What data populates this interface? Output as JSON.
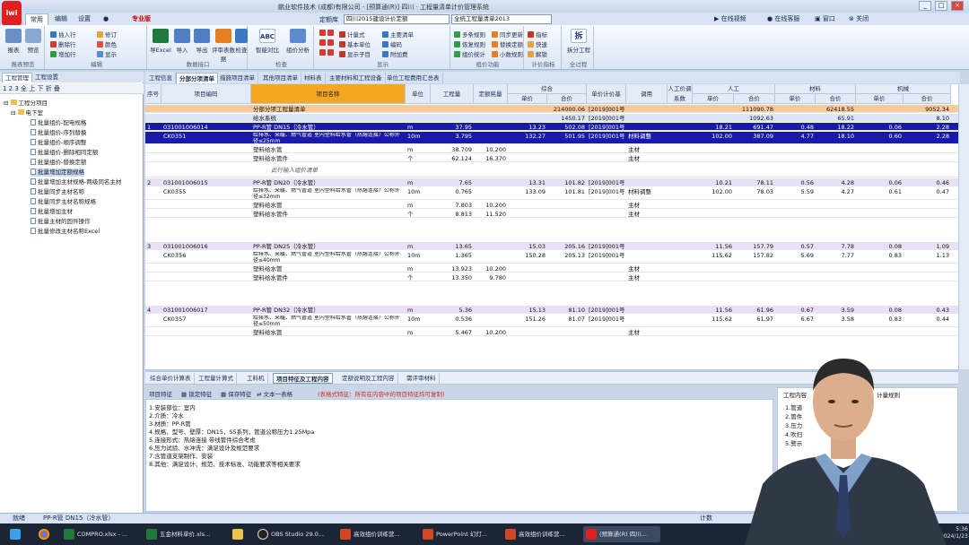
{
  "app": {
    "logo": "iwi",
    "title": "鹏业软件技术 (成都)有限公司 · [预算通(R)] 四川 · 工程量清单计价管理系统"
  },
  "ribbon_tabs": [
    "常用",
    "编辑",
    "设置",
    "",
    "专业版"
  ],
  "combo": {
    "quota_label": "定额库",
    "quota_value": "四川2015建设计价定额",
    "bill_value": "全统工程量清单2013"
  },
  "top_links": [
    "在线视频",
    "在线客服",
    "窗口",
    "关闭"
  ],
  "ribbon_groups": [
    {
      "label": "报表预览",
      "big": [
        "报表",
        "预览"
      ]
    },
    {
      "label": "编辑",
      "small": [
        "插入行",
        "删除行",
        "增加行",
        "修订",
        "颜色",
        "显示"
      ]
    },
    {
      "label": "数据接口",
      "big": [
        "导Excel",
        "导入",
        "导出",
        "评审表数据",
        "检查"
      ]
    },
    {
      "label": "检查",
      "big": [
        "智能对比",
        "组价分析"
      ]
    },
    {
      "label": "显示",
      "small": [
        "计量式",
        "主要清单",
        "多条规则",
        "基本单位",
        "编码",
        "恢复规则",
        "显示子目",
        "附加费",
        "组价统计"
      ]
    },
    {
      "label": "组价功能",
      "small": [
        "同步更新",
        "替换定额",
        "小数规则"
      ]
    },
    {
      "label": "计价指标",
      "small": [
        "指标",
        "快速",
        "解锁"
      ]
    },
    {
      "label": "全过程",
      "big": [
        "拆分工程"
      ]
    }
  ],
  "sidebar": {
    "tabs": [
      "工程管理",
      "工程设置"
    ],
    "tools": "1 2 3  全  上  下  折  叠",
    "root": "工程分项目",
    "folder": "电下室",
    "items": [
      "批量组价-配电规格",
      "批量组价-序列替换",
      "批量组价-顺序调整",
      "批量组价-删除相同定额",
      "批量组价-替换定额",
      "批量增加定额规格",
      "批量增加主材规格-两级同名主材",
      "批量同步主材名称",
      "批量同步主材名称规格",
      "批量增加主材",
      "批量主材的固件操作",
      "批量修改主材名称Excel"
    ]
  },
  "main_tabs": [
    "工程信息",
    "分部分项清单",
    "措施项目清单",
    "其他项目清单",
    "材料表",
    "主要材料和工程设备",
    "单位工程费用汇总表"
  ],
  "grid_headers": {
    "seq": "序号",
    "code": "项目编码",
    "name": "项目名称",
    "unit": "单位",
    "qty": "工程量",
    "quota_qty": "定额耗量",
    "composite": "综合",
    "unit_price": "单价",
    "total": "合价",
    "basis": "单价计价基",
    "adjust": "调用",
    "labor_coef": "人工价调系数",
    "labor": "人工",
    "material": "材料",
    "machine": "机械"
  },
  "rows": [
    {
      "seq": "",
      "code": "",
      "name": "分部分项工程量清单",
      "unit": "",
      "qty": "",
      "qq": "",
      "price": "",
      "total": "214000.06",
      "basis": "[2019]001号",
      "adj": "",
      "lp": "",
      "lt": "111090.78",
      "mp": "",
      "mt": "62418.55",
      "kp": "",
      "kt": "9052.34",
      "kind": "sum"
    },
    {
      "seq": "",
      "code": "",
      "name": "给水系统",
      "unit": "",
      "qty": "",
      "qq": "",
      "price": "",
      "total": "1450.17",
      "basis": "[2019]001号",
      "adj": "",
      "lp": "",
      "lt": "1092.63",
      "mp": "",
      "mt": "65.91",
      "kp": "",
      "kt": "8.10",
      "kind": "sub"
    },
    {
      "seq": "1",
      "code": "031001006014",
      "name": "PP-R管 DN15（冷水管）",
      "unit": "m",
      "qty": "37.95",
      "qq": "",
      "price": "13.23",
      "total": "502.08",
      "basis": "[2019]001号",
      "adj": "",
      "lp": "18.21",
      "lt": "691.47",
      "mp": "0.48",
      "mt": "18.22",
      "kp": "0.06",
      "kt": "2.28",
      "kind": "sel"
    },
    {
      "seq": "",
      "code": "CK0351",
      "name": "给排水、采暖、燃气管道 室内塑料给水管（热熔连接）公称外径≤25mm",
      "unit": "10m",
      "qty": "3.795",
      "qq": "",
      "price": "132.27",
      "total": "501.95",
      "basis": "[2019]001号",
      "adj": "材料调整",
      "lp": "102.00",
      "lt": "387.09",
      "mp": "4.77",
      "mt": "18.10",
      "kp": "0.60",
      "kt": "2.28",
      "kind": "sel"
    },
    {
      "seq": "",
      "code": "",
      "name": "塑料给水管",
      "unit": "m",
      "qty": "38.709",
      "qq": "10.200",
      "price": "",
      "total": "",
      "basis": "",
      "adj": "主材",
      "lp": "",
      "lt": "",
      "mp": "",
      "mt": "",
      "kp": "",
      "kt": "",
      "kind": "mat"
    },
    {
      "seq": "",
      "code": "",
      "name": "塑料给水管件",
      "unit": "个",
      "qty": "62.124",
      "qq": "16.370",
      "price": "",
      "total": "",
      "basis": "",
      "adj": "主材",
      "lp": "",
      "lt": "",
      "mp": "",
      "mt": "",
      "kp": "",
      "kt": "",
      "kind": "mat"
    },
    {
      "seq": "",
      "code": "",
      "name": "此行输入组价清单",
      "unit": "",
      "qty": "",
      "qq": "",
      "price": "",
      "total": "",
      "basis": "",
      "adj": "",
      "lp": "",
      "lt": "",
      "mp": "",
      "mt": "",
      "kp": "",
      "kt": "",
      "kind": "hint"
    },
    {
      "seq": "2",
      "code": "031001006015",
      "name": "PP-R管 DN20（冷水管）",
      "unit": "m",
      "qty": "7.65",
      "qq": "",
      "price": "13.31",
      "total": "101.82",
      "basis": "[2019]001号",
      "adj": "",
      "lp": "10.21",
      "lt": "78.11",
      "mp": "0.56",
      "mt": "4.28",
      "kp": "0.06",
      "kt": "0.46",
      "kind": "item"
    },
    {
      "seq": "",
      "code": "CK0355",
      "name": "给排水、采暖、燃气管道 室内塑料给水管（热熔连接）公称外径≤32mm",
      "unit": "10m",
      "qty": "0.765",
      "qq": "",
      "price": "133.09",
      "total": "101.81",
      "basis": "[2019]001号",
      "adj": "材料调整",
      "lp": "102.00",
      "lt": "78.03",
      "mp": "5.59",
      "mt": "4.27",
      "kp": "0.61",
      "kt": "0.47",
      "kind": "quota"
    },
    {
      "seq": "",
      "code": "",
      "name": "塑料给水管",
      "unit": "m",
      "qty": "7.803",
      "qq": "10.200",
      "price": "",
      "total": "",
      "basis": "",
      "adj": "主材",
      "lp": "",
      "lt": "",
      "mp": "",
      "mt": "",
      "kp": "",
      "kt": "",
      "kind": "mat"
    },
    {
      "seq": "",
      "code": "",
      "name": "塑料给水管件",
      "unit": "个",
      "qty": "8.813",
      "qq": "11.520",
      "price": "",
      "total": "",
      "basis": "",
      "adj": "主材",
      "lp": "",
      "lt": "",
      "mp": "",
      "mt": "",
      "kp": "",
      "kt": "",
      "kind": "mat"
    },
    {
      "seq": "3",
      "code": "031001006016",
      "name": "PP-R管 DN25（冷水管）",
      "unit": "m",
      "qty": "13.65",
      "qq": "",
      "price": "15.03",
      "total": "205.16",
      "basis": "[2019]001号",
      "adj": "",
      "lp": "11.56",
      "lt": "157.79",
      "mp": "0.57",
      "mt": "7.78",
      "kp": "0.08",
      "kt": "1.09",
      "kind": "item"
    },
    {
      "seq": "",
      "code": "CK0356",
      "name": "给排水、采暖、燃气管道 室内塑料给水管（热熔连接）公称外径≤40mm",
      "unit": "10m",
      "qty": "1.365",
      "qq": "",
      "price": "150.28",
      "total": "205.13",
      "basis": "[2019]001号",
      "adj": "",
      "lp": "115.62",
      "lt": "157.82",
      "mp": "5.69",
      "mt": "7.77",
      "kp": "0.83",
      "kt": "1.13",
      "kind": "quota"
    },
    {
      "seq": "",
      "code": "",
      "name": "塑料给水管",
      "unit": "m",
      "qty": "13.923",
      "qq": "10.200",
      "price": "",
      "total": "",
      "basis": "",
      "adj": "主材",
      "lp": "",
      "lt": "",
      "mp": "",
      "mt": "",
      "kp": "",
      "kt": "",
      "kind": "mat"
    },
    {
      "seq": "",
      "code": "",
      "name": "塑料给水管件",
      "unit": "个",
      "qty": "13.350",
      "qq": "9.780",
      "price": "",
      "total": "",
      "basis": "",
      "adj": "主材",
      "lp": "",
      "lt": "",
      "mp": "",
      "mt": "",
      "kp": "",
      "kt": "",
      "kind": "mat"
    },
    {
      "seq": "4",
      "code": "031001006017",
      "name": "PP-R管 DN32（冷水管）",
      "unit": "m",
      "qty": "5.36",
      "qq": "",
      "price": "15.13",
      "total": "81.10",
      "basis": "[2019]001号",
      "adj": "",
      "lp": "11.56",
      "lt": "61.96",
      "mp": "0.67",
      "mt": "3.59",
      "kp": "0.08",
      "kt": "0.43",
      "kind": "item"
    },
    {
      "seq": "",
      "code": "CK0357",
      "name": "给排水、采暖、燃气管道 室内塑料给水管（热熔连接）公称外径≤50mm",
      "unit": "10m",
      "qty": "0.536",
      "qq": "",
      "price": "151.26",
      "total": "81.07",
      "basis": "[2019]001号",
      "adj": "",
      "lp": "115.62",
      "lt": "61.97",
      "mp": "6.67",
      "mt": "3.58",
      "kp": "0.83",
      "kt": "0.44",
      "kind": "quota"
    },
    {
      "seq": "",
      "code": "",
      "name": "塑料给水管",
      "unit": "m",
      "qty": "5.467",
      "qq": "10.200",
      "price": "",
      "total": "",
      "basis": "",
      "adj": "主材",
      "lp": "",
      "lt": "",
      "mp": "",
      "mt": "",
      "kp": "",
      "kt": "",
      "kind": "mat"
    }
  ],
  "bottom_tabs": [
    "综合单价计算表",
    "工程量计算式",
    "工料机",
    "项目特征及工程内容",
    "定额说明及工程内容",
    "需评审材料"
  ],
  "bottom_tools": {
    "feature": "项目特征",
    "lock": "锁定特征",
    "save": "保存特征",
    "text": "文本一表格",
    "warning": "(表格式特征：所有在内容中的项目特征均可复制)"
  },
  "feature_lines": [
    "1.安装部位：室内",
    "2.介质：冷水",
    "3.材质：PP-R管",
    "4.规格、型号、壁厚：DN15，S5系列，管道公称压力1.25Mpa",
    "5.连接形式：热熔连接 带线管件综合考虑",
    "6.压力试验、水冲洗：满足设计及规范要求",
    "7.含管道支架制作、安装",
    "8.其他：满足设计、规范、技术标准、功能要求等相关要求"
  ],
  "right_panel": {
    "title": "工程内容",
    "subtitle": "计量规则",
    "lines": [
      "1.管道",
      "2.管件",
      "3.压力",
      "4.吹扫",
      "5.警示"
    ]
  },
  "status": {
    "left": "就绪",
    "item": "PP-R管 DN15（冷水管）",
    "count": "计数"
  },
  "taskbar": [
    "",
    "",
    "COMPRO.xlsx - ...",
    "五金材料单价.xls...",
    "",
    "OBS Studio 29.0...",
    "高效组价训练营...",
    "PowerPoint 幻灯...",
    "高效组价训练营...",
    "(预算通(R) 四川..."
  ],
  "clock": [
    "5:36",
    "2024/1/23"
  ],
  "colors": {
    "accent": "#f5a623",
    "selected_row": "#1a1aa8",
    "summary_row": "#f8c99a",
    "item_row": "#e9dff7"
  }
}
